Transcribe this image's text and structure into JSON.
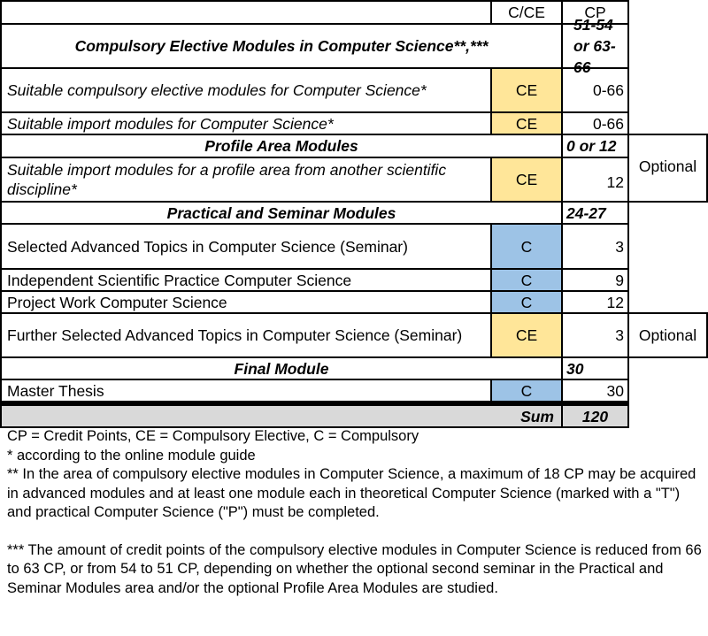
{
  "colors": {
    "compulsory_elective": "#FFE699",
    "compulsory": "#9DC3E6",
    "sum_row": "#D9D9D9"
  },
  "table": {
    "headers": {
      "type": "C/CE",
      "cp": "CP"
    },
    "sections": [
      {
        "title": "Compulsory Elective Modules in Computer Science**,***",
        "cp": "51-54 or 63-66",
        "rows": [
          {
            "label": "Suitable compulsory elective modules for Computer Science*",
            "type": "CE",
            "cp": "0-66"
          },
          {
            "label": "Suitable import modules for Computer Science*",
            "type": "CE",
            "cp": "0-66"
          }
        ]
      },
      {
        "title": "Profile Area Modules",
        "cp": "0 or 12",
        "note": "Optional",
        "rows": [
          {
            "label": "Suitable import modules for a profile area from another scientific discipline*",
            "type": "CE",
            "cp": "12"
          }
        ]
      },
      {
        "title": "Practical and Seminar Modules",
        "cp": "24-27",
        "rows": [
          {
            "label": "Selected Advanced Topics in Computer Science (Seminar)",
            "type": "C",
            "cp": "3"
          },
          {
            "label": "Independent Scientific Practice Computer Science",
            "type": "C",
            "cp": "9"
          },
          {
            "label": "Project Work Computer Science",
            "type": "C",
            "cp": "12"
          },
          {
            "label": "Further Selected Advanced Topics in Computer Science (Seminar)",
            "type": "CE",
            "cp": "3",
            "note": "Optional"
          }
        ]
      },
      {
        "title": "Final Module",
        "cp": "30",
        "rows": [
          {
            "label": "Master Thesis",
            "type": "C",
            "cp": "30"
          }
        ]
      }
    ],
    "sum": {
      "label": "Sum",
      "cp": "120"
    }
  },
  "footnotes": {
    "legend": "CP = Credit Points, CE = Compulsory Elective, C = Compulsory",
    "single": "* according to the online module guide",
    "double": "** In the area of compulsory elective modules in Computer Science, a maximum of 18 CP may be acquired in advanced modules and at least one module each in theoretical Computer Science (marked with a \"T\") and practical Computer Science (\"P\") must be completed.",
    "triple": "*** The amount of credit points of the compulsory elective modules in Computer Science is reduced from 66 to 63 CP, or from 54 to 51 CP, depending on whether the optional second seminar in the Practical and Seminar Modules area and/or the optional Profile Area Modules are studied."
  }
}
